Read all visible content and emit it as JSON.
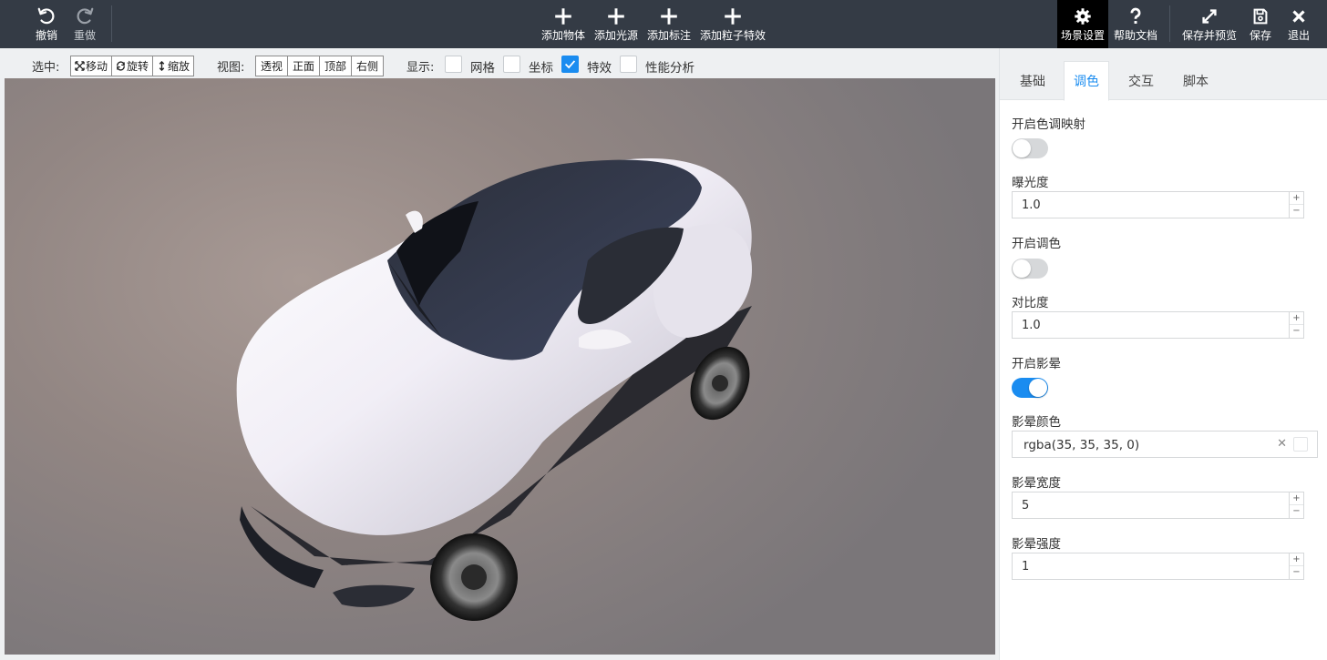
{
  "toolbar": {
    "undo": {
      "label": "撤销",
      "icon": "undo-icon"
    },
    "redo": {
      "label": "重做",
      "icon": "redo-icon"
    },
    "add_object": {
      "label": "添加物体",
      "icon": "plus-icon"
    },
    "add_light": {
      "label": "添加光源",
      "icon": "plus-icon"
    },
    "add_annotation": {
      "label": "添加标注",
      "icon": "plus-icon"
    },
    "add_particle": {
      "label": "添加粒子特效",
      "icon": "plus-icon"
    },
    "scene_settings": {
      "label": "场景设置",
      "icon": "gear-icon"
    },
    "help_docs": {
      "label": "帮助文档",
      "icon": "question-icon"
    },
    "save_preview": {
      "label": "保存并预览",
      "icon": "expand-icon"
    },
    "save": {
      "label": "保存",
      "icon": "save-icon"
    },
    "exit": {
      "label": "退出",
      "icon": "close-icon"
    }
  },
  "subbar": {
    "select_label": "选中:",
    "select_modes": [
      "移动",
      "旋转",
      "缩放"
    ],
    "view_label": "视图:",
    "views": [
      "透视",
      "正面",
      "顶部",
      "右侧"
    ],
    "display_label": "显示:",
    "display_options": [
      {
        "label": "网格",
        "checked": false
      },
      {
        "label": "坐标",
        "checked": false
      },
      {
        "label": "特效",
        "checked": true
      },
      {
        "label": "性能分析",
        "checked": false
      }
    ]
  },
  "panel": {
    "tabs": [
      "基础",
      "调色",
      "交互",
      "脚本"
    ],
    "active_tab": "调色",
    "tone_mapping": {
      "label": "开启色调映射",
      "enabled": false
    },
    "exposure": {
      "label": "曝光度",
      "value": "1.0"
    },
    "color_grading": {
      "label": "开启调色",
      "enabled": false
    },
    "contrast": {
      "label": "对比度",
      "value": "1.0"
    },
    "vignette": {
      "label": "开启影晕",
      "enabled": true
    },
    "vignette_color": {
      "label": "影晕颜色",
      "value": "rgba(35, 35, 35, 0)"
    },
    "vignette_width": {
      "label": "影晕宽度",
      "value": "5"
    },
    "vignette_strength": {
      "label": "影晕强度",
      "value": "1"
    }
  },
  "colors": {
    "accent": "#1a8cf0",
    "toolbar_bg": "#343b45",
    "viewport_bg": "#928683"
  }
}
